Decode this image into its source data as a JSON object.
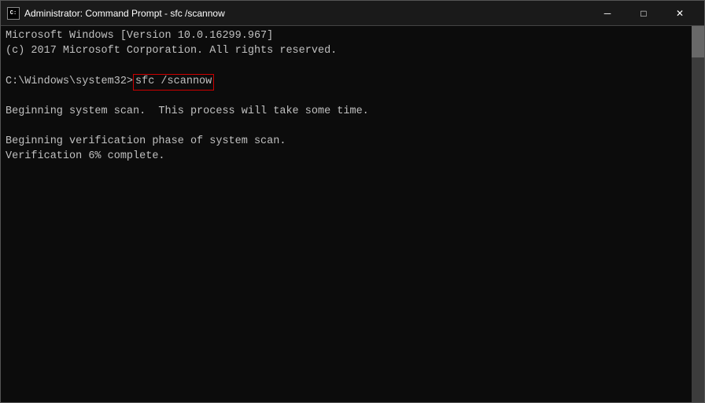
{
  "window": {
    "title": "Administrator: Command Prompt - sfc /scannow",
    "icon_label": "cmd-icon"
  },
  "titlebar": {
    "minimize_label": "─",
    "maximize_label": "□",
    "close_label": "✕"
  },
  "console": {
    "line1": "Microsoft Windows [Version 10.0.16299.967]",
    "line2": "(c) 2017 Microsoft Corporation. All rights reserved.",
    "line3": "",
    "prompt": "C:\\Windows\\system32>",
    "command": "sfc /scannow",
    "line4": "",
    "line5": "Beginning system scan.  This process will take some time.",
    "line6": "",
    "line7": "Beginning verification phase of system scan.",
    "line8": "Verification 6% complete."
  }
}
